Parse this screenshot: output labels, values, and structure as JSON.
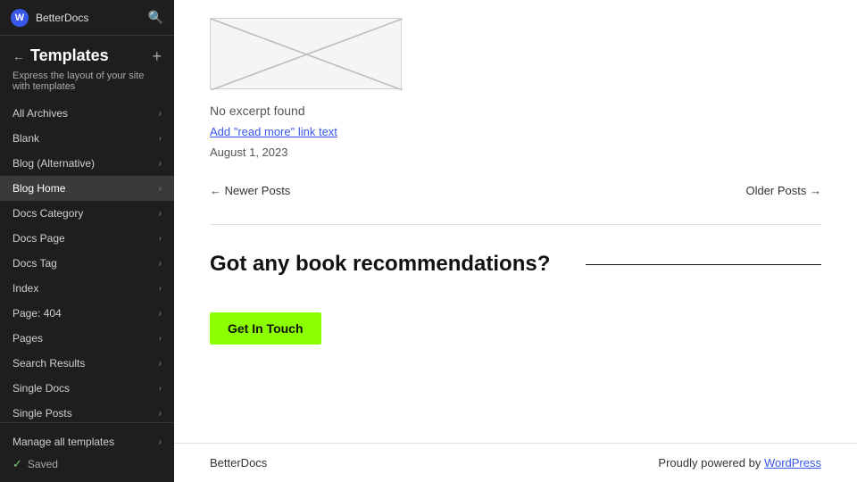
{
  "sidebar": {
    "top_bar": {
      "site_name": "BetterDocs",
      "search_icon": "🔍"
    },
    "back_icon": "←",
    "title": "Templates",
    "add_icon": "+",
    "subtitle": "Express the layout of your site with templates",
    "nav_items": [
      {
        "label": "All Archives",
        "active": false
      },
      {
        "label": "Blank",
        "active": false
      },
      {
        "label": "Blog (Alternative)",
        "active": false
      },
      {
        "label": "Blog Home",
        "active": true
      },
      {
        "label": "Docs Category",
        "active": false
      },
      {
        "label": "Docs Page",
        "active": false
      },
      {
        "label": "Docs Tag",
        "active": false
      },
      {
        "label": "Index",
        "active": false
      },
      {
        "label": "Page: 404",
        "active": false
      },
      {
        "label": "Pages",
        "active": false
      },
      {
        "label": "Search Results",
        "active": false
      },
      {
        "label": "Single Docs",
        "active": false
      },
      {
        "label": "Single Posts",
        "active": false
      }
    ],
    "footer": {
      "manage_label": "Manage all templates",
      "saved_label": "Saved"
    }
  },
  "main": {
    "no_excerpt": "No excerpt found",
    "add_read_more": "Add \"read more\" link text",
    "post_date": "August 1, 2023",
    "pagination": {
      "newer": "← Newer Posts",
      "older": "Older Posts →"
    },
    "cta": {
      "text": "Got any book recommendations?",
      "button_label": "Get In Touch"
    },
    "footer": {
      "site_name": "BetterDocs",
      "powered_text": "Proudly powered by WordPress"
    }
  }
}
